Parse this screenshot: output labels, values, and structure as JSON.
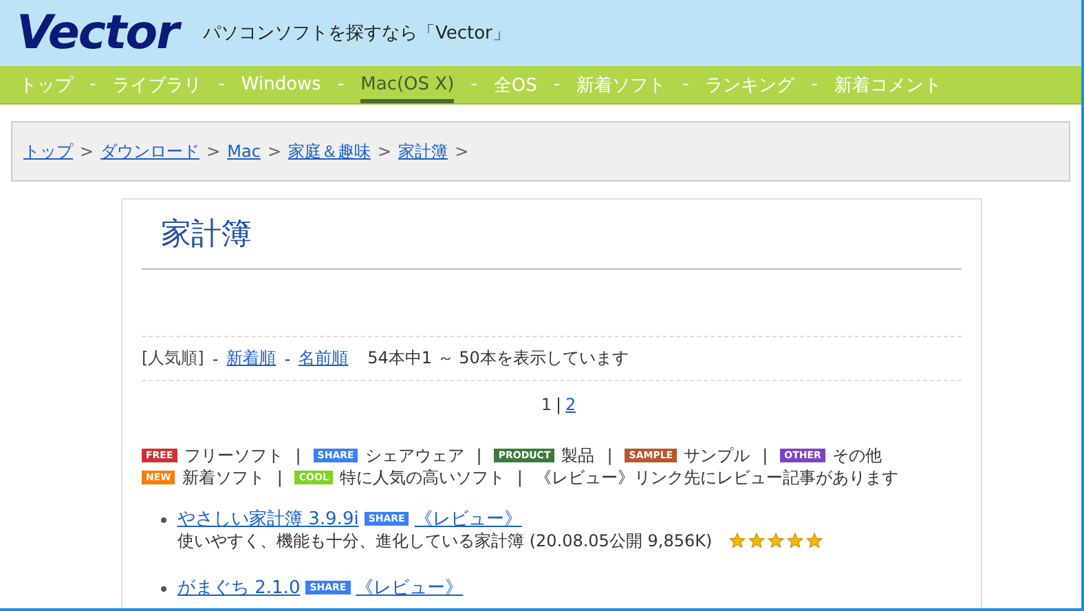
{
  "header": {
    "logo": "Vector",
    "tagline": "パソコンソフトを探すなら「Vector」"
  },
  "nav": {
    "items": [
      {
        "label": "トップ",
        "selected": false
      },
      {
        "sep": "-",
        "label": "ライブラリ",
        "selected": false
      },
      {
        "sep": "-",
        "label": "Windows",
        "selected": false
      },
      {
        "sep": "-",
        "label": "Mac(OS X)",
        "selected": true
      },
      {
        "sep": "-",
        "label": "全OS",
        "selected": false
      },
      {
        "sep": "-",
        "label": "新着ソフト",
        "selected": false
      },
      {
        "sep": "-",
        "label": "ランキング",
        "selected": false
      },
      {
        "sep": "-",
        "label": "新着コメント",
        "selected": false
      }
    ]
  },
  "breadcrumb": [
    {
      "label": "トップ",
      "sep": ">"
    },
    {
      "label": "ダウンロード",
      "sep": ">"
    },
    {
      "label": "Mac",
      "sep": ">"
    },
    {
      "label": "家庭＆趣味",
      "sep": ">"
    },
    {
      "label": "家計簿",
      "sep": ">"
    }
  ],
  "page_title": "家計簿",
  "sort": {
    "options": [
      {
        "label": "[人気順]",
        "selected": true
      },
      {
        "sep": "-",
        "label": "新着順",
        "selected": false
      },
      {
        "sep": "-",
        "label": "名前順",
        "selected": false
      }
    ],
    "count": "54本中1 ～ 50本を表示しています"
  },
  "pager": [
    {
      "label": "1",
      "selected": true
    },
    {
      "sep": "|",
      "label": "2",
      "selected": false
    }
  ],
  "legend": [
    [
      {
        "badge": "FREE",
        "color": "#d03030",
        "label": "フリーソフト"
      },
      {
        "sep": "|",
        "badge": "SHARE",
        "color": "#3b7ff0",
        "label": "シェアウェア"
      },
      {
        "sep": "|",
        "badge": "PRODUCT",
        "color": "#3c7a3c",
        "label": "製品"
      },
      {
        "sep": "|",
        "badge": "SAMPLE",
        "color": "#b8552a",
        "label": "サンプル"
      },
      {
        "sep": "|",
        "badge": "OTHER",
        "color": "#7a44c4",
        "label": "その他"
      }
    ],
    [
      {
        "badge": "NEW",
        "color": "#ff7a00",
        "label": "新着ソフト"
      },
      {
        "sep": "|",
        "badge": "COOL",
        "color": "#7fd321",
        "label": "特に人気の高いソフト"
      },
      {
        "sep": "|",
        "label": "《レビュー》リンク先にレビュー記事があります"
      }
    ]
  ],
  "software": [
    {
      "title": "やさしい家計簿 3.9.9i",
      "badge": "SHARE",
      "color": "#3b7ff0",
      "review": "《レビュー》",
      "description": "使いやすく、機能も十分、進化している家計簿 (20.08.05公開 9,856K)",
      "stars": 5
    },
    {
      "title": "がまぐち 2.1.0",
      "badge": "SHARE",
      "color": "#3b7ff0",
      "review": "《レビュー》"
    }
  ]
}
